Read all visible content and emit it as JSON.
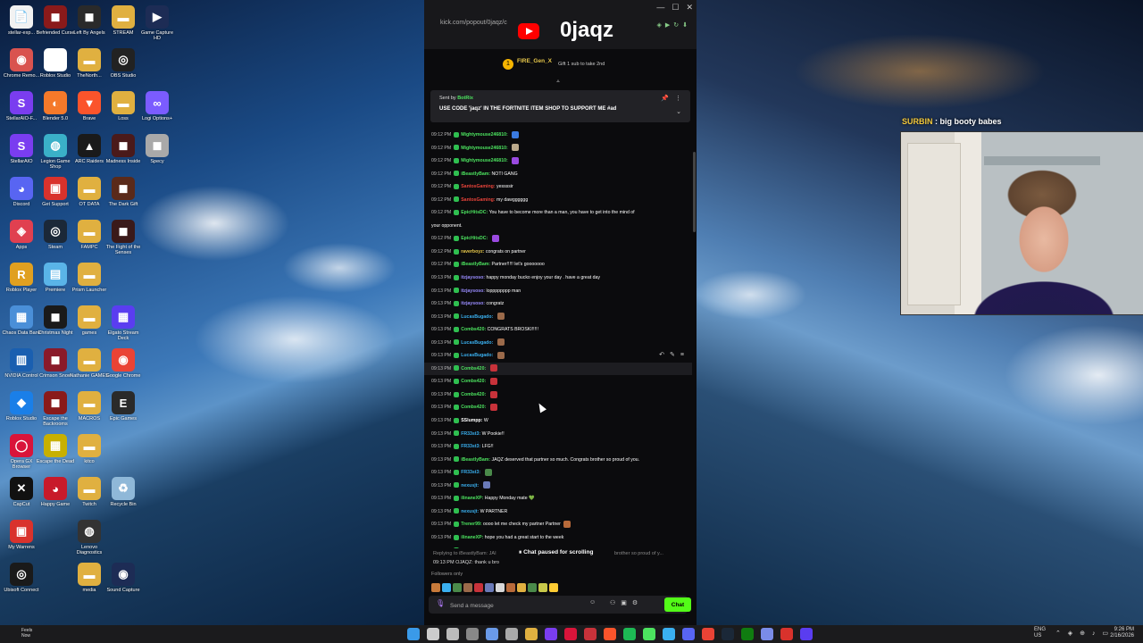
{
  "desktop": {
    "icons": [
      {
        "label": "stellar-exp...",
        "color": "#f2f2f2",
        "glyph": "📄",
        "col": 0,
        "row": 0
      },
      {
        "label": "Befriended Curse",
        "color": "#8a1a1a",
        "glyph": "◼",
        "col": 1,
        "row": 0
      },
      {
        "label": "Left By Angels",
        "color": "#2a2a2a",
        "glyph": "◼",
        "col": 2,
        "row": 0
      },
      {
        "label": "STREAM",
        "color": "#e0b040",
        "glyph": "▬",
        "col": 3,
        "row": 0
      },
      {
        "label": "Game Capture HD",
        "color": "#1d2c55",
        "glyph": "▶",
        "col": 4,
        "row": 0
      },
      {
        "label": "Chrome Remo...",
        "color": "#d9534f",
        "glyph": "◉",
        "col": 0,
        "row": 1
      },
      {
        "label": "Roblox Studio",
        "color": "#ffffff",
        "glyph": "◆",
        "col": 1,
        "row": 1
      },
      {
        "label": "TheNorth...",
        "color": "#e0b040",
        "glyph": "▬",
        "col": 2,
        "row": 1
      },
      {
        "label": "OBS Studio",
        "color": "#222",
        "glyph": "◎",
        "col": 3,
        "row": 1
      },
      {
        "label": "StellarAIO-F...",
        "color": "#7a3df0",
        "glyph": "S",
        "col": 0,
        "row": 2
      },
      {
        "label": "Blender 5.0",
        "color": "#f5792a",
        "glyph": "◐",
        "col": 1,
        "row": 2
      },
      {
        "label": "Brave",
        "color": "#fb542b",
        "glyph": "▼",
        "col": 2,
        "row": 2
      },
      {
        "label": "Loss",
        "color": "#e0b040",
        "glyph": "▬",
        "col": 3,
        "row": 2
      },
      {
        "label": "Logi Options+",
        "color": "#7b5cff",
        "glyph": "∞",
        "col": 4,
        "row": 2
      },
      {
        "label": "StellarAIO",
        "color": "#7a3df0",
        "glyph": "S",
        "col": 0,
        "row": 3
      },
      {
        "label": "Legion Game Shop",
        "color": "#3ab0c8",
        "glyph": "◍",
        "col": 1,
        "row": 3
      },
      {
        "label": "ARC Raiders",
        "color": "#1a1a1a",
        "glyph": "▲",
        "col": 2,
        "row": 3
      },
      {
        "label": "Madness Inside",
        "color": "#4a1a1a",
        "glyph": "◼",
        "col": 3,
        "row": 3
      },
      {
        "label": "Specy",
        "color": "#a9a9a9",
        "glyph": "◼",
        "col": 4,
        "row": 3
      },
      {
        "label": "Discord",
        "color": "#5865f2",
        "glyph": "◕",
        "col": 0,
        "row": 4
      },
      {
        "label": "Get Support",
        "color": "#d9322c",
        "glyph": "▣",
        "col": 1,
        "row": 4
      },
      {
        "label": "OT DATA",
        "color": "#e0b040",
        "glyph": "▬",
        "col": 2,
        "row": 4
      },
      {
        "label": "The Dark Gift",
        "color": "#5a2a1a",
        "glyph": "◼",
        "col": 3,
        "row": 4
      },
      {
        "label": "Apps",
        "color": "#e04050",
        "glyph": "◈",
        "col": 0,
        "row": 5
      },
      {
        "label": "Steam",
        "color": "#1b2838",
        "glyph": "◎",
        "col": 1,
        "row": 5
      },
      {
        "label": "FAMPC",
        "color": "#e0b040",
        "glyph": "▬",
        "col": 2,
        "row": 5
      },
      {
        "label": "The Fight of the Senses",
        "color": "#3a1a1a",
        "glyph": "◼",
        "col": 3,
        "row": 5
      },
      {
        "label": "Roblox Player",
        "color": "#e0a020",
        "glyph": "R",
        "col": 0,
        "row": 6
      },
      {
        "label": "Premiere",
        "color": "#5ab4e8",
        "glyph": "▤",
        "col": 1,
        "row": 6
      },
      {
        "label": "Prism Launcher",
        "color": "#e0b040",
        "glyph": "▬",
        "col": 2,
        "row": 6
      },
      {
        "label": "Chaos Data Bank",
        "color": "#4a8fd8",
        "glyph": "▦",
        "col": 0,
        "row": 7
      },
      {
        "label": "Christmas Night",
        "color": "#1a1a1a",
        "glyph": "◼",
        "col": 1,
        "row": 7
      },
      {
        "label": "games",
        "color": "#e0b040",
        "glyph": "▬",
        "col": 2,
        "row": 7
      },
      {
        "label": "Elgato Stream Deck",
        "color": "#5a3df0",
        "glyph": "▦",
        "col": 3,
        "row": 7
      },
      {
        "label": "NVIDIA Control",
        "color": "#1a5fb0",
        "glyph": "▥",
        "col": 0,
        "row": 8
      },
      {
        "label": "Crimson Snow",
        "color": "#8a1a2a",
        "glyph": "◼",
        "col": 1,
        "row": 8
      },
      {
        "label": "Nathanie GAMES",
        "color": "#e0b040",
        "glyph": "▬",
        "col": 2,
        "row": 8
      },
      {
        "label": "Google Chrome",
        "color": "#ea4335",
        "glyph": "◉",
        "col": 3,
        "row": 8
      },
      {
        "label": "Roblox Studio",
        "color": "#1a7fe8",
        "glyph": "◆",
        "col": 0,
        "row": 9
      },
      {
        "label": "Escape the Backrooms",
        "color": "#8a1a1a",
        "glyph": "◼",
        "col": 1,
        "row": 9
      },
      {
        "label": "MACROS",
        "color": "#e0b040",
        "glyph": "▬",
        "col": 2,
        "row": 9
      },
      {
        "label": "Epic Games",
        "color": "#2a2a2a",
        "glyph": "E",
        "col": 3,
        "row": 9
      },
      {
        "label": "Opera GX Browser",
        "color": "#d9143a",
        "glyph": "◯",
        "col": 0,
        "row": 10
      },
      {
        "label": "Escape the Dead",
        "color": "#c8b000",
        "glyph": "▦",
        "col": 1,
        "row": 10
      },
      {
        "label": "kitco",
        "color": "#e0b040",
        "glyph": "▬",
        "col": 2,
        "row": 10
      },
      {
        "label": "CapCut",
        "color": "#111",
        "glyph": "✕",
        "col": 0,
        "row": 11
      },
      {
        "label": "Happy Game",
        "color": "#c81a2a",
        "glyph": "◕",
        "col": 1,
        "row": 11
      },
      {
        "label": "Twitch",
        "color": "#e0b040",
        "glyph": "▬",
        "col": 2,
        "row": 11
      },
      {
        "label": "Recycle Bin",
        "color": "#8fb8d8",
        "glyph": "♻",
        "col": 3,
        "row": 11
      },
      {
        "label": "My Warrens",
        "color": "#d9322c",
        "glyph": "▣",
        "col": 0,
        "row": 12
      },
      {
        "label": "Lenovo Diagnostics",
        "color": "#333",
        "glyph": "◍",
        "col": 2,
        "row": 12
      },
      {
        "label": "Ubisoft Connect",
        "color": "#1a1a1a",
        "glyph": "◎",
        "col": 0,
        "row": 13
      },
      {
        "label": "media",
        "color": "#e0b040",
        "glyph": "▬",
        "col": 2,
        "row": 13
      },
      {
        "label": "Sound Capture",
        "color": "#1d2c55",
        "glyph": "◉",
        "col": 3,
        "row": 13
      }
    ]
  },
  "chat": {
    "url": "kick.com/popout/0jaqz/c",
    "streamer": "0jaqz",
    "gift": {
      "badge": "1",
      "user": "FIRE_Gen_X",
      "text": "Gift 1 sub to take 2nd"
    },
    "pinned": {
      "sent_by": "Sent by",
      "bot": "BotRix",
      "message": "USE CODE 'jaqz' IN THE FORTNITE ITEM SHOP TO SUPPORT ME #ad"
    },
    "messages": [
      {
        "time": "09:12 PM",
        "user": "Mightymouse246810:",
        "text": "",
        "color": "#4ce35f",
        "emote": "#3a7ae0"
      },
      {
        "time": "09:12 PM",
        "user": "Mightymouse246810:",
        "text": "",
        "color": "#4ce35f",
        "emote": "#bba98c"
      },
      {
        "time": "09:12 PM",
        "user": "Mightymouse246810:",
        "text": "",
        "color": "#4ce35f",
        "emote": "#9a4ae0"
      },
      {
        "time": "09:12 PM",
        "user": "iBeastlyBam:",
        "text": "NOTI GANG",
        "color": "#4ce35f",
        "emote": ""
      },
      {
        "time": "09:12 PM",
        "user": "SantosGaming:",
        "text": "yessssir",
        "color": "#e8433a",
        "emote": ""
      },
      {
        "time": "09:12 PM",
        "user": "SantosGaming:",
        "text": "my dawgggggg",
        "color": "#e8433a",
        "emote": ""
      },
      {
        "time": "09:12 PM",
        "user": "EpicHitsDC:",
        "text": "You have to become more than a man, you have to get into the mind of",
        "color": "#4ce35f",
        "emote": ""
      },
      {
        "time": "",
        "user": "",
        "text": "your opponent.",
        "color": "#4ce35f",
        "emote": ""
      },
      {
        "time": "09:12 PM",
        "user": "EpicHitsDC:",
        "text": "",
        "color": "#4ce35f",
        "emote": "#9a4ae0"
      },
      {
        "time": "09:12 PM",
        "user": "raverboyz:",
        "text": "congrats on partner",
        "color": "#e8c84a",
        "emote": ""
      },
      {
        "time": "09:12 PM",
        "user": "iBeastlyBam:",
        "text": "Partner!!!!! let's gooooooo",
        "color": "#4ce35f",
        "emote": ""
      },
      {
        "time": "09:13 PM",
        "user": "itzjaysoso:",
        "text": "happy monday bucko enjoy your day . have a great day",
        "color": "#9a8cff",
        "emote": ""
      },
      {
        "time": "09:13 PM",
        "user": "itzjaysoso:",
        "text": "lopppppppp man",
        "color": "#9a8cff",
        "emote": ""
      },
      {
        "time": "09:13 PM",
        "user": "itzjaysoso:",
        "text": "congratz",
        "color": "#9a8cff",
        "emote": ""
      },
      {
        "time": "09:13 PM",
        "user": "LucasBugado:",
        "text": "",
        "color": "#3ab0f0",
        "emote": "#9b6a4a"
      },
      {
        "time": "09:13 PM",
        "user": "Combs420:",
        "text": "CONGRATS BROSKI!!!!!",
        "color": "#4ce35f",
        "emote": ""
      },
      {
        "time": "09:13 PM",
        "user": "LucasBugado:",
        "text": "",
        "color": "#3ab0f0",
        "emote": "#9b6a4a"
      },
      {
        "time": "09:13 PM",
        "user": "LucasBugado:",
        "text": "",
        "color": "#3ab0f0",
        "emote": "#9b6a4a"
      },
      {
        "time": "09:13 PM",
        "user": "Combs420:",
        "text": "",
        "color": "#4ce35f",
        "emote": "#c8323a"
      },
      {
        "time": "09:13 PM",
        "user": "Combs420:",
        "text": "",
        "color": "#4ce35f",
        "emote": "#c8323a"
      },
      {
        "time": "09:13 PM",
        "user": "Combs420:",
        "text": "",
        "color": "#4ce35f",
        "emote": "#c8323a"
      },
      {
        "time": "09:13 PM",
        "user": "Combs420:",
        "text": "",
        "color": "#4ce35f",
        "emote": "#c8323a"
      },
      {
        "time": "09:13 PM",
        "user": "SSlumpp:",
        "text": "W",
        "color": "#ffffff",
        "emote": ""
      },
      {
        "time": "09:13 PM",
        "user": "FR33st3:",
        "text": "W Pookie!!",
        "color": "#3ab0f0",
        "emote": ""
      },
      {
        "time": "09:13 PM",
        "user": "FR33st3:",
        "text": "LFG!!",
        "color": "#3ab0f0",
        "emote": ""
      },
      {
        "time": "09:13 PM",
        "user": "iBeastlyBam:",
        "text": "JAQZ deserved that partner so much. Congrats brother so proud of you.",
        "color": "#4ce35f",
        "emote": ""
      },
      {
        "time": "09:13 PM",
        "user": "FR33st3:",
        "text": "",
        "color": "#3ab0f0",
        "emote": "#4a8a4a"
      },
      {
        "time": "09:13 PM",
        "user": "nexusjt:",
        "text": "",
        "color": "#3ab0f0",
        "emote": "#6a7ab8"
      },
      {
        "time": "09:13 PM",
        "user": "ilinaneXP:",
        "text": "Happy Monday mate 💚",
        "color": "#4ce35f",
        "emote": ""
      },
      {
        "time": "09:13 PM",
        "user": "nexusjt:",
        "text": "W PARTNER",
        "color": "#3ab0f0",
        "emote": ""
      },
      {
        "time": "09:13 PM",
        "user": "Trener99:",
        "text": "oooo let me check my partner Partner",
        "color": "#4ce35f",
        "emote": "#b86a3a"
      },
      {
        "time": "09:13 PM",
        "user": "ilinaneXP:",
        "text": "hope you had a great start to the week",
        "color": "#4ce35f",
        "emote": ""
      },
      {
        "time": "09:13 PM",
        "user": "Trener99:",
        "text": "❤",
        "color": "#4ce35f",
        "emote": ""
      }
    ],
    "paused": {
      "reply": "Replying to iBeastlyBam: JAI",
      "pill": "Chat paused for scrolling",
      "reply_tail": "brother so proud of y...",
      "last": "09:13 PM  OJAQZ: thank u bro"
    },
    "followers_only": "Followers only",
    "emote_colors": [
      "#c87a3a",
      "#3ab0f0",
      "#4a8a4a",
      "#9b6a4a",
      "#c8323a",
      "#6a7ab8",
      "#d8d8d8",
      "#b86a3a",
      "#e0b040",
      "#4a8a4a",
      "#c8c84a",
      "#ffcc33"
    ],
    "input_placeholder": "Send a message",
    "send_label": "Chat"
  },
  "overlay": {
    "user": "SURBIN",
    "message": "big booty babes"
  },
  "taskbar": {
    "weather": "Feels\nNow",
    "time": "9:26 PM",
    "date": "2/16/2026",
    "lang": "ENG\nUS",
    "apps": [
      {
        "name": "start",
        "color": "#3a9ae8"
      },
      {
        "name": "search",
        "color": "#cccccc"
      },
      {
        "name": "task-view",
        "color": "#bbbbbb"
      },
      {
        "name": "app",
        "color": "#888888"
      },
      {
        "name": "app",
        "color": "#6a9ae8"
      },
      {
        "name": "settings",
        "color": "#aaaaaa"
      },
      {
        "name": "explorer",
        "color": "#e0b040"
      },
      {
        "name": "stellar",
        "color": "#7a3df0"
      },
      {
        "name": "opera",
        "color": "#d9143a"
      },
      {
        "name": "app",
        "color": "#c8323a"
      },
      {
        "name": "brave",
        "color": "#fb542b"
      },
      {
        "name": "spotify",
        "color": "#1db954"
      },
      {
        "name": "app",
        "color": "#4ce35f"
      },
      {
        "name": "app",
        "color": "#3ab0f0"
      },
      {
        "name": "discord",
        "color": "#5865f2"
      },
      {
        "name": "chrome",
        "color": "#ea4335"
      },
      {
        "name": "steam",
        "color": "#1b2838"
      },
      {
        "name": "xbox",
        "color": "#107c10"
      },
      {
        "name": "app",
        "color": "#7a8ce8"
      },
      {
        "name": "app",
        "color": "#d9322c"
      },
      {
        "name": "stream-deck",
        "color": "#5a3df0"
      }
    ]
  }
}
